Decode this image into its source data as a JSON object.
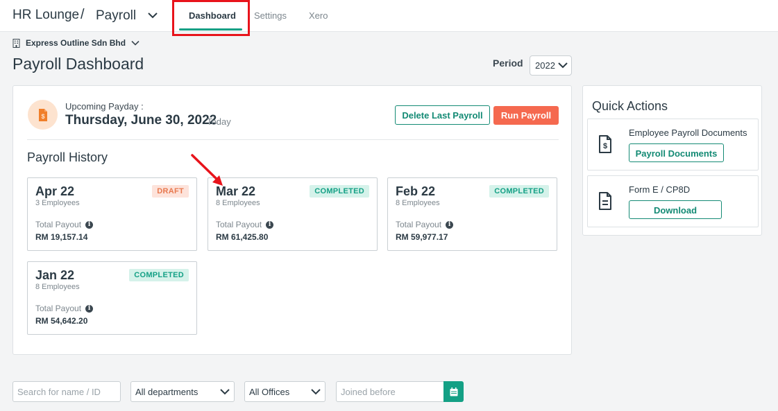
{
  "topbar": {
    "brand": "HR Lounge",
    "separator": "/",
    "module": "Payroll",
    "tabs": [
      {
        "label": "Dashboard",
        "active": true
      },
      {
        "label": "Settings",
        "active": false
      },
      {
        "label": "Xero",
        "active": false
      }
    ]
  },
  "company": {
    "name": "Express Outline Sdn Bhd",
    "icon": "building-icon"
  },
  "header": {
    "title": "Payroll Dashboard",
    "period_label": "Period",
    "period_value": "2022"
  },
  "payday": {
    "label": "Upcoming Payday :",
    "date": "Thursday, June 30, 2022",
    "today": "Today",
    "icon": "payslip-icon"
  },
  "actions": {
    "delete_label": "Delete Last Payroll",
    "run_label": "Run Payroll"
  },
  "history": {
    "title": "Payroll History",
    "payout_label": "Total Payout",
    "items": [
      {
        "month": "Apr 22",
        "employees": "3 Employees",
        "status": "DRAFT",
        "payout": "RM 19,157.14"
      },
      {
        "month": "Mar 22",
        "employees": "8 Employees",
        "status": "COMPLETED",
        "payout": "RM 61,425.80"
      },
      {
        "month": "Feb 22",
        "employees": "8 Employees",
        "status": "COMPLETED",
        "payout": "RM 59,977.17"
      },
      {
        "month": "Jan 22",
        "employees": "8 Employees",
        "status": "COMPLETED",
        "payout": "RM 54,642.20"
      }
    ]
  },
  "quick_actions": {
    "title": "Quick Actions",
    "items": [
      {
        "label": "Employee Payroll Documents",
        "button": "Payroll Documents",
        "icon": "dollar-document-icon"
      },
      {
        "label": "Form E / CP8D",
        "button": "Download",
        "icon": "document-icon"
      }
    ]
  },
  "filters": {
    "search_placeholder": "Search for name / ID",
    "department": "All departments",
    "office": "All Offices",
    "joined_placeholder": "Joined before"
  },
  "colors": {
    "accent": "#14a085",
    "run_button": "#f5694f",
    "highlight_box": "#e8131b",
    "annotation_arrow": "#e8131b"
  }
}
